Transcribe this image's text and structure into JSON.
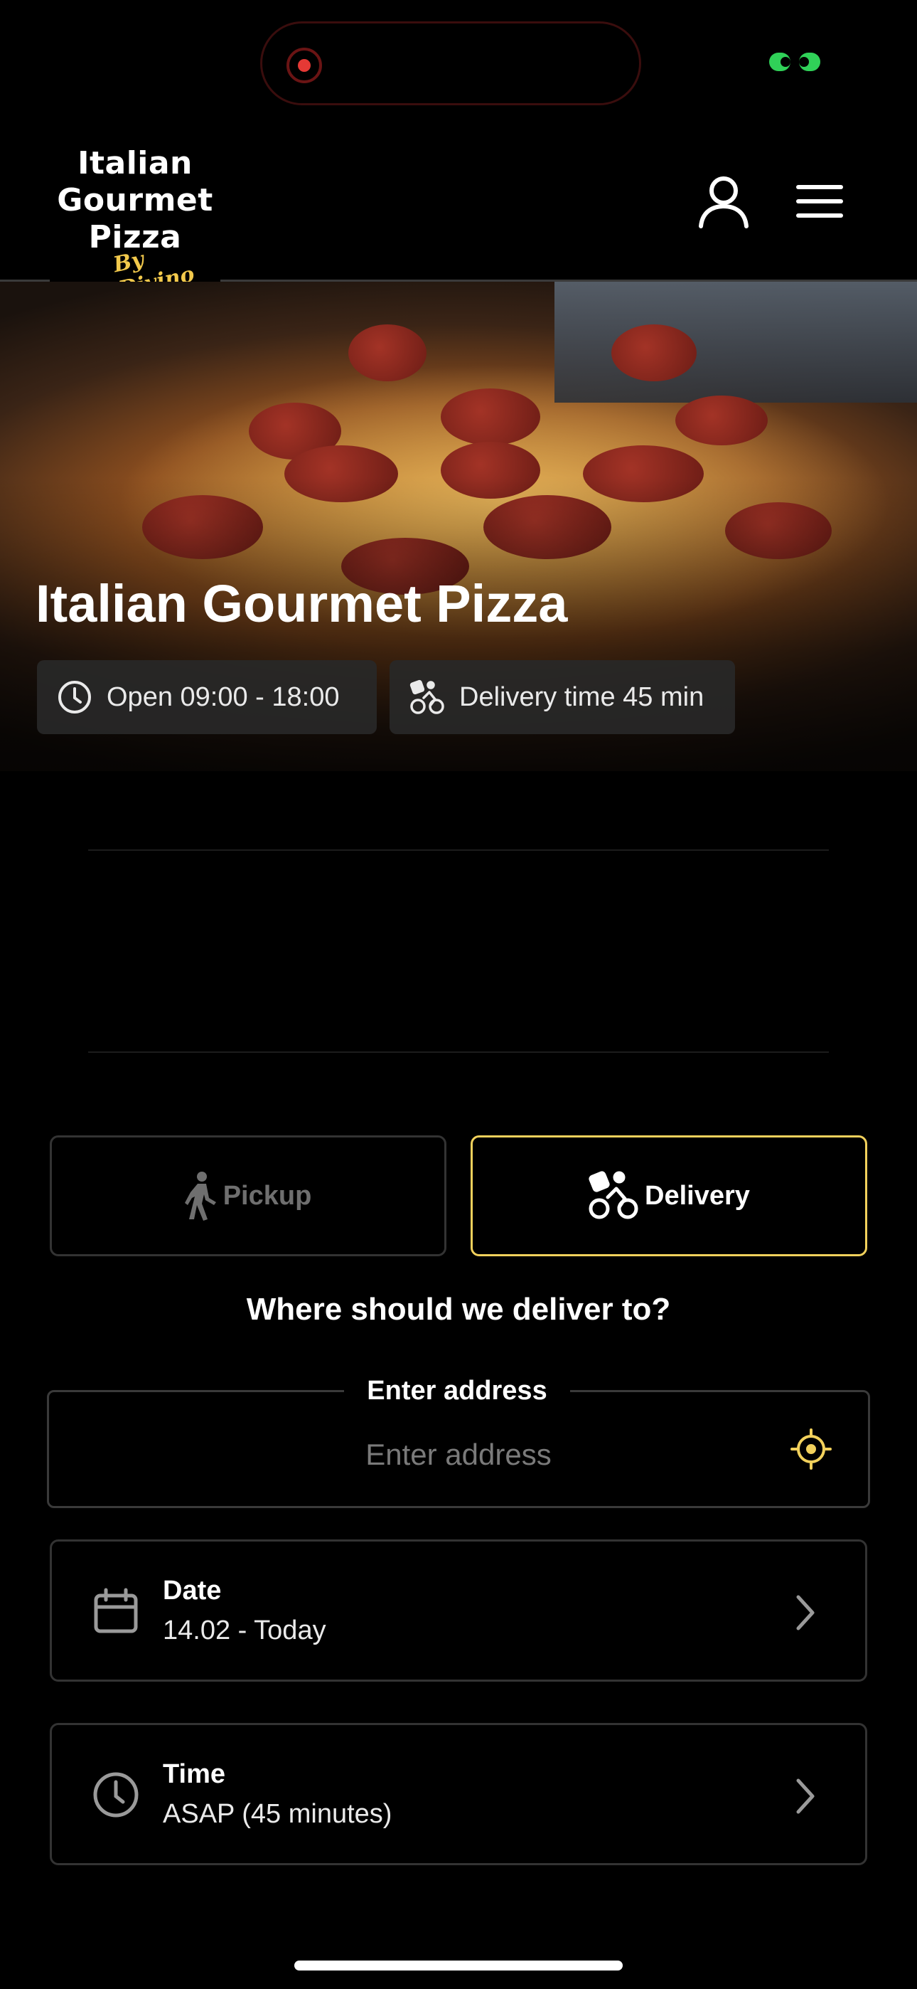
{
  "header": {
    "logo_line1": "Italian",
    "logo_line2": "Gourmet",
    "logo_line3": "Pizza",
    "logo_sub": "By Divino"
  },
  "hero": {
    "title": "Italian Gourmet Pizza",
    "hours_chip": "Open 09:00 - 18:00",
    "delivery_chip": "Delivery time 45 min"
  },
  "order_mode": {
    "options": [
      {
        "label": "Pickup",
        "icon": "walking-person-icon",
        "selected": false
      },
      {
        "label": "Delivery",
        "icon": "delivery-bike-icon",
        "selected": true
      }
    ]
  },
  "address": {
    "question": "Where should we deliver to?",
    "legend": "Enter address",
    "placeholder": "Enter address",
    "value": ""
  },
  "date": {
    "title": "Date",
    "value": "14.02 - Today"
  },
  "time": {
    "title": "Time",
    "value": "ASAP (45 minutes)"
  },
  "colors": {
    "accent": "#f2d15c",
    "background": "#000000",
    "recording": "#e53935",
    "link": "#30d158"
  }
}
